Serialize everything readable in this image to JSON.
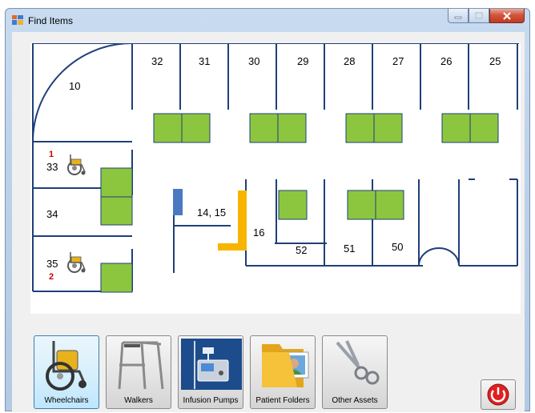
{
  "window": {
    "title": "Find Items",
    "controls": {
      "minimize": "minimize",
      "maximize": "maximize",
      "close": "close"
    }
  },
  "colors": {
    "wall": "#1f3f7a",
    "bed": "#8cc63f",
    "bed_border": "#1f3f7a",
    "blue_marker": "#4a79c0",
    "orange_marker": "#f7b500",
    "alert_number": "#cc0000",
    "active_tool": "#3c7fb1",
    "exit_red": "#e02020"
  },
  "floor_plan": {
    "rooms": {
      "r10": "10",
      "r32": "32",
      "r31": "31",
      "r30": "30",
      "r29": "29",
      "r28": "28",
      "r27": "27",
      "r26": "26",
      "r25": "25",
      "r33": "33",
      "r34": "34",
      "r35": "35",
      "r14_15": "14, 15",
      "r16": "16",
      "r52": "52",
      "r51": "51",
      "r50": "50"
    },
    "item_counts": {
      "room33": "1",
      "room35": "2"
    },
    "item_icons": [
      "wheelchair-icon",
      "wheelchair-icon"
    ]
  },
  "tools": {
    "selected": "Wheelchairs",
    "wheelchairs": "Wheelchairs",
    "walkers": "Walkers",
    "infusion_pumps": "Infusion Pumps",
    "patient_folders": "Patient Folders",
    "other_assets": "Other Assets"
  },
  "exit": {
    "icon": "power-icon"
  }
}
